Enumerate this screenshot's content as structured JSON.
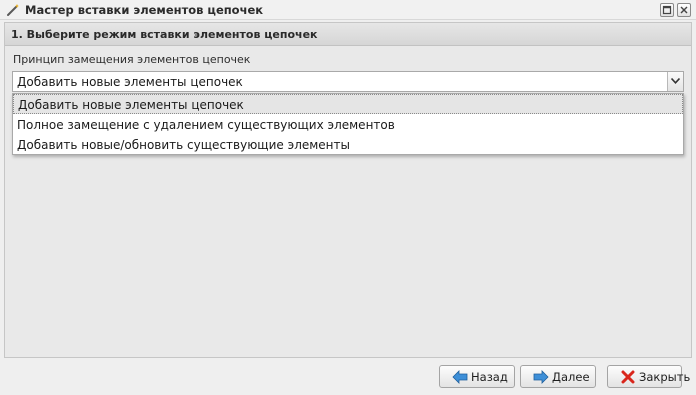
{
  "window": {
    "title": "Мастер вставки элементов цепочек",
    "icon": "magic-wand-icon",
    "controls": [
      "maximize-icon",
      "close-icon"
    ]
  },
  "section": {
    "title": "1. Выберите режим вставки элементов цепочек"
  },
  "field": {
    "label": "Принцип замещения элементов цепочек",
    "value": "Добавить новые элементы цепочек",
    "options": [
      "Добавить новые элементы цепочек",
      "Полное замещение с удалением существующих элементов",
      "Добавить новые/обновить существующие элементы"
    ],
    "selected_index": 0
  },
  "buttons": {
    "back": {
      "label": "Назад",
      "icon": "arrow-left-icon"
    },
    "next": {
      "label": "Далее",
      "icon": "arrow-right-icon"
    },
    "close": {
      "label": "Закрыть",
      "icon": "red-x-icon"
    }
  },
  "colors": {
    "arrow_blue": "#3d8fd8",
    "close_red": "#d9261c",
    "selected_item_bg": "#e5e5e5"
  }
}
